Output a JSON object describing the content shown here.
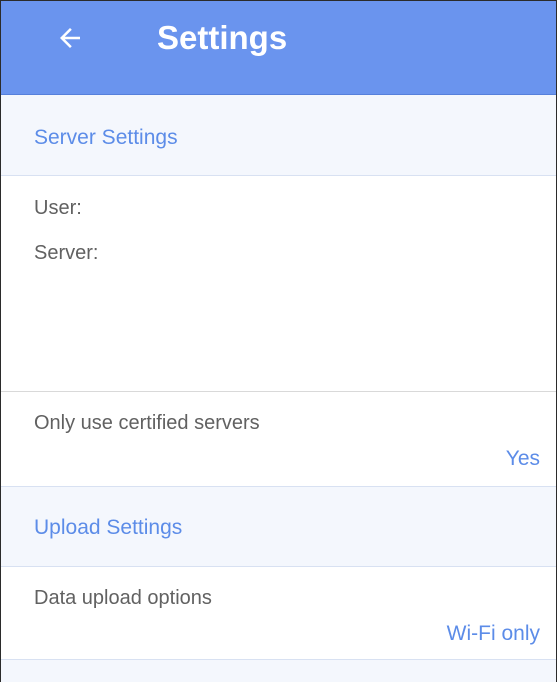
{
  "header": {
    "title": "Settings",
    "back_icon": "arrow-left-icon",
    "background_color": "#6a94ee"
  },
  "server_section": {
    "title": "Server Settings",
    "user_label": "User:",
    "server_label": "Server:",
    "certified": {
      "label": "Only use certified servers",
      "value": "Yes"
    }
  },
  "upload_section": {
    "title": "Upload Settings",
    "data_upload": {
      "label": "Data upload options",
      "value": "Wi-Fi only"
    }
  },
  "accent_color": "#5c8ce8"
}
